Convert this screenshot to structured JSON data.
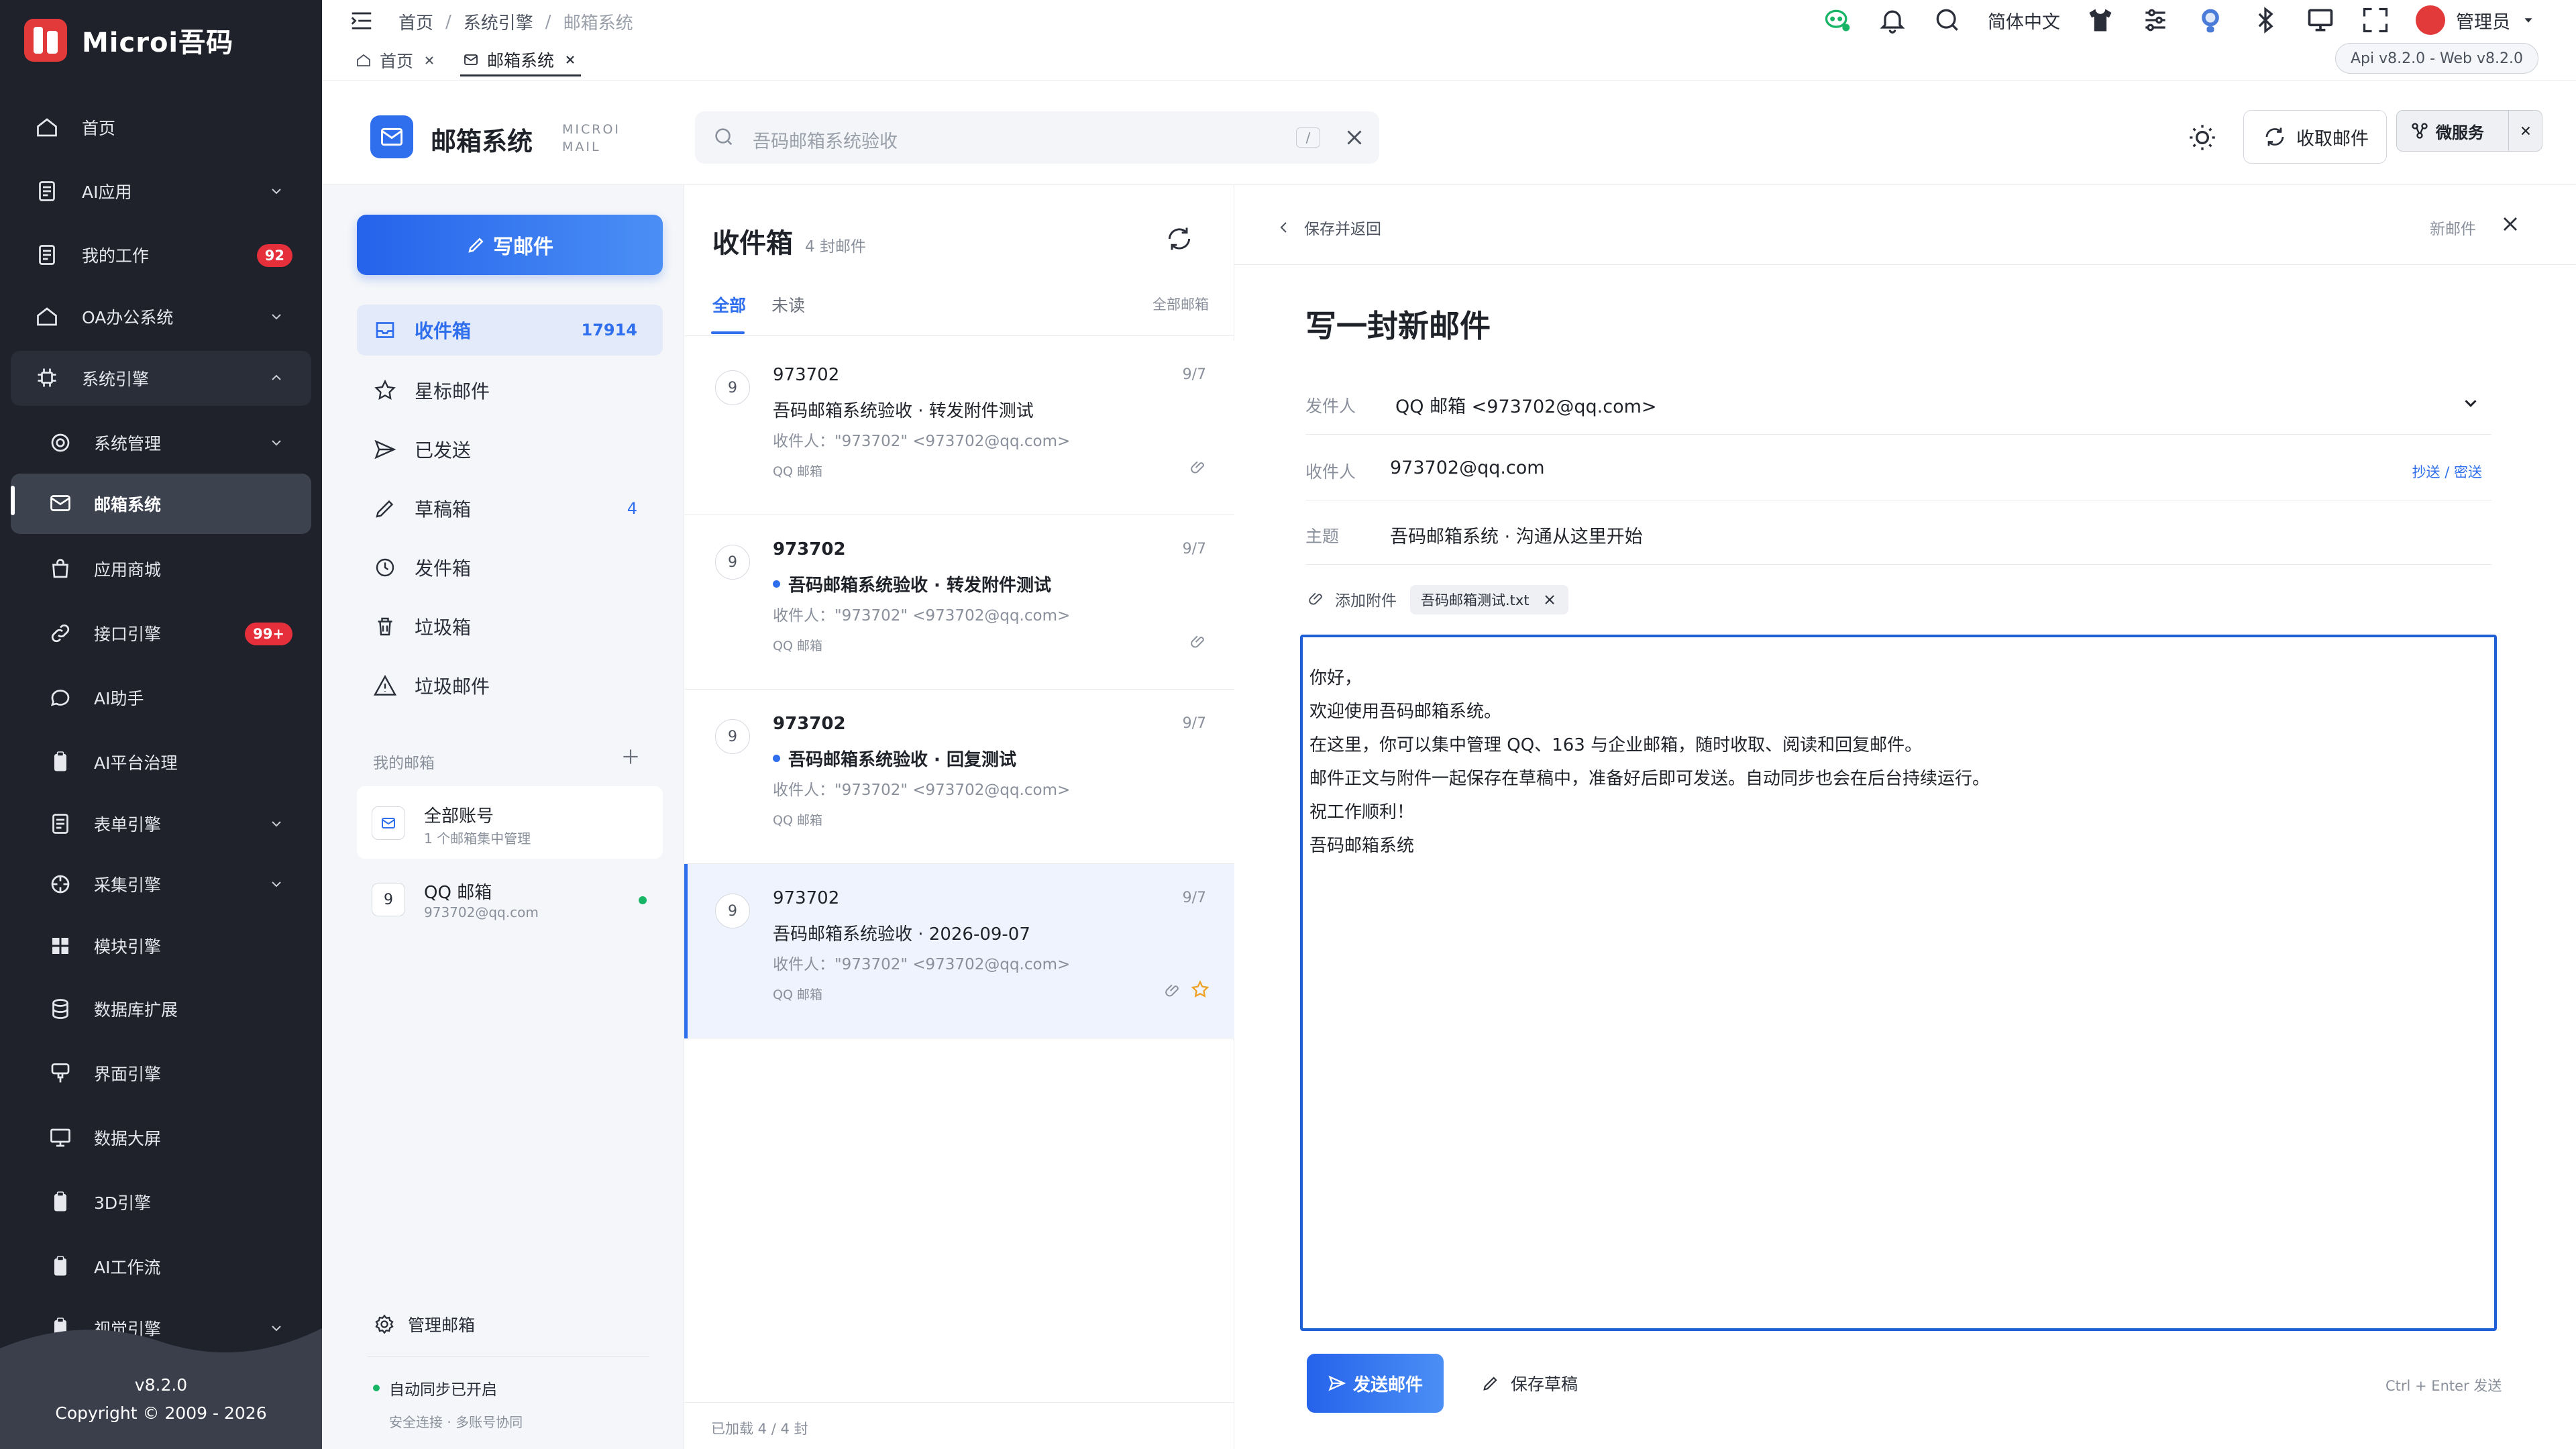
{
  "brand": {
    "name": "Microi吾码"
  },
  "sidebar": {
    "items": [
      {
        "label": "首页"
      },
      {
        "label": "AI应用"
      },
      {
        "label": "我的工作",
        "badge": "92"
      },
      {
        "label": "OA办公系统"
      },
      {
        "label": "系统引擎"
      },
      {
        "label": "系统管理"
      },
      {
        "label": "邮箱系统"
      },
      {
        "label": "应用商城"
      },
      {
        "label": "接口引擎",
        "badge": "99+"
      },
      {
        "label": "AI助手"
      },
      {
        "label": "AI平台治理"
      },
      {
        "label": "表单引擎"
      },
      {
        "label": "采集引擎"
      },
      {
        "label": "模块引擎"
      },
      {
        "label": "数据库扩展"
      },
      {
        "label": "界面引擎"
      },
      {
        "label": "数据大屏"
      },
      {
        "label": "3D引擎"
      },
      {
        "label": "AI工作流"
      },
      {
        "label": "视觉引擎"
      }
    ],
    "version": "v8.2.0",
    "copyright": "Copyright © 2009 - 2026"
  },
  "topbar": {
    "breadcrumbs": [
      "首页",
      "系统引擎",
      "邮箱系统"
    ],
    "separator": "/",
    "tabs": [
      {
        "label": "首页"
      },
      {
        "label": "邮箱系统"
      }
    ],
    "language": "简体中文",
    "user": "管理员",
    "version_pill": "Api v8.2.0 - Web v8.2.0"
  },
  "app": {
    "title": "邮箱系统",
    "subtitle_line1": "MICROI",
    "subtitle_line2": "MAIL",
    "search_placeholder": "吾码邮箱系统验收",
    "search_shortcut": "/",
    "fetch_label": "收取邮件",
    "micro_label": "微服务",
    "accent": "#2f6fed"
  },
  "mailnav": {
    "compose_label": "写邮件",
    "folders": [
      {
        "label": "收件箱",
        "count": "17914"
      },
      {
        "label": "星标邮件"
      },
      {
        "label": "已发送"
      },
      {
        "label": "草稿箱",
        "count": "4"
      },
      {
        "label": "发件箱"
      },
      {
        "label": "垃圾箱"
      },
      {
        "label": "垃圾邮件"
      }
    ],
    "my_mail_label": "我的邮箱",
    "accounts": [
      {
        "name": "全部账号",
        "desc": "1 个邮箱集中管理"
      },
      {
        "initial": "9",
        "name": "QQ 邮箱",
        "desc": "973702@qq.com"
      }
    ],
    "manage_label": "管理邮箱",
    "sync_status": "自动同步已开启",
    "sync_sub": "安全连接 · 多账号协同"
  },
  "maillist": {
    "title": "收件箱",
    "count": "4 封邮件",
    "tab_all": "全部",
    "tab_unread": "未读",
    "all_mailboxes": "全部邮箱",
    "mails": [
      {
        "initial": "9",
        "from": "973702",
        "date": "9/7",
        "subject": "吾码邮箱系统验收 · 转发附件测试",
        "to": "收件人：\"973702\" <973702@qq.com>",
        "account": "QQ 邮箱"
      },
      {
        "initial": "9",
        "from": "973702",
        "date": "9/7",
        "subject": "吾码邮箱系统验收 · 转发附件测试",
        "to": "收件人：\"973702\" <973702@qq.com>",
        "account": "QQ 邮箱"
      },
      {
        "initial": "9",
        "from": "973702",
        "date": "9/7",
        "subject": "吾码邮箱系统验收 · 回复测试",
        "to": "收件人：\"973702\" <973702@qq.com>",
        "account": "QQ 邮箱"
      },
      {
        "initial": "9",
        "from": "973702",
        "date": "9/7",
        "subject": "吾码邮箱系统验收 · 2026-09-07",
        "to": "收件人：\"973702\" <973702@qq.com>",
        "account": "QQ 邮箱"
      }
    ],
    "footer": "已加载 4 / 4 封"
  },
  "compose": {
    "back_label": "保存并返回",
    "new_label": "新邮件",
    "heading": "写一封新邮件",
    "from_label": "发件人",
    "from_value": "QQ 邮箱 <973702@qq.com>",
    "to_label": "收件人",
    "to_value": "973702@qq.com",
    "cc_bcc": "抄送 / 密送",
    "subject_label": "主题",
    "subject_value": "吾码邮箱系统 · 沟通从这里开始",
    "attach_label": "添加附件",
    "attachment": "吾码邮箱测试.txt",
    "body": [
      "你好，",
      "欢迎使用吾码邮箱系统。",
      "在这里，你可以集中管理 QQ、163 与企业邮箱，随时收取、阅读和回复邮件。",
      "邮件正文与附件一起保存在草稿中，准备好后即可发送。自动同步也会在后台持续运行。",
      "祝工作顺利！",
      "吾码邮箱系统"
    ],
    "send_label": "发送邮件",
    "draft_label": "保存草稿",
    "shortcut_hint": "Ctrl + Enter 发送"
  }
}
